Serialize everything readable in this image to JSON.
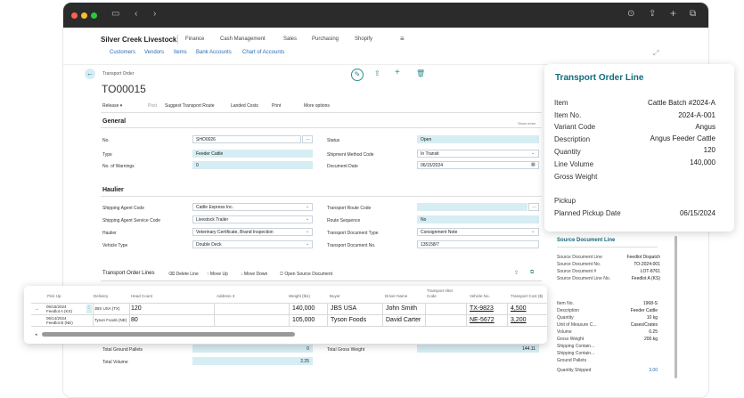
{
  "app": {
    "brand": "Silver Creek Livestock",
    "menu": [
      "Finance",
      "Cash Management",
      "Sales",
      "Purchasing",
      "Shopify"
    ],
    "subnav": [
      "Customers",
      "Vendors",
      "Items",
      "Bank Accounts",
      "Chart of Accounts"
    ]
  },
  "page": {
    "caption": "Transport Order",
    "number": "TO00015",
    "actions": [
      "Release",
      "Post",
      "Suggest Transport Route",
      "Landed Costs",
      "Print",
      "More options"
    ],
    "show_more": "Show more"
  },
  "general": {
    "title": "General",
    "fields_left": [
      {
        "label": "No.",
        "value": "SHO0026"
      },
      {
        "label": "Type",
        "value": "Feeder Cattle"
      },
      {
        "label": "No. of Warnings",
        "value": "0"
      }
    ],
    "fields_right": [
      {
        "label": "Status",
        "value": "Open"
      },
      {
        "label": "Shipment Method Code",
        "value": "In Transit"
      },
      {
        "label": "Document Date",
        "value": "06/15/2024"
      }
    ]
  },
  "haulier": {
    "title": "Haulier",
    "fields_left": [
      {
        "label": "Shipping Agent Code",
        "value": "Cattle Express Inc."
      },
      {
        "label": "Shipping Agent Service Code",
        "value": "Livestock Trailer"
      },
      {
        "label": "Haulier",
        "value": "Veterinary Certificate, Brand Inspection"
      },
      {
        "label": "Vehicle Type",
        "value": "Double Deck"
      }
    ],
    "fields_right": [
      {
        "label": "Transport Route Code",
        "value": ""
      },
      {
        "label": "Route Sequence",
        "value": "No"
      },
      {
        "label": "Transport Document Type",
        "value": "Consignment Note"
      },
      {
        "label": "Transport Document No.",
        "value": "135158/7"
      }
    ]
  },
  "lines": {
    "title": "Transport Order Lines",
    "actions": [
      "Delete Line",
      "Move Up",
      "Move Down",
      "Open Source Document"
    ],
    "headers": [
      "Pick Up",
      "Delivery",
      "Head Count",
      "Address 3",
      "Weight (lbs)",
      "Buyer",
      "Driver Name",
      "Transport Alter Code",
      "Vehicle No.",
      "Transport Cost ($)"
    ],
    "rows": [
      {
        "pickup": "06/15/2024",
        "pickup_sub": "Feedlot A (KS)",
        "delivery": "JBS USA (TX)",
        "head": "120",
        "weight": "140,000",
        "buyer": "JBS USA",
        "driver": "John Smith",
        "vehicle": "TX-9823",
        "cost": "4,500"
      },
      {
        "pickup": "06/14/2024",
        "pickup_sub": "Feedlot B (NE)",
        "delivery": "Tyson Foods (NE)",
        "head": "80",
        "weight": "105,000",
        "buyer": "Tyson Foods",
        "driver": "David Carter",
        "vehicle": "NE-5672",
        "cost": "3,200"
      }
    ]
  },
  "totals": {
    "rows": [
      {
        "label": "Total Ground Pallets",
        "value": "0"
      },
      {
        "label": "Total Volume",
        "value": "2.25"
      }
    ],
    "gross_label": "Total Gross Weight",
    "gross_value": "144.11"
  },
  "panel": {
    "title": "Transport Order Line",
    "rows": [
      {
        "label": "Item",
        "value": "Cattle Batch #2024-A"
      },
      {
        "label": "Item No.",
        "value": "2024-A-001"
      },
      {
        "label": "Variant Code",
        "value": "Angus"
      },
      {
        "label": "Description",
        "value": "Angus Feeder Cattle"
      },
      {
        "label": "Quantity",
        "value": "120"
      },
      {
        "label": "Line Volume",
        "value": "140,000"
      },
      {
        "label": "Gross Weight",
        "value": ""
      }
    ],
    "pickup_title": "Pickup",
    "pickup_date_label": "Planned Pickup Date",
    "pickup_date_value": "06/15/2024"
  },
  "source": {
    "title": "Source Document Line",
    "rows": [
      {
        "label": "Source Document Line",
        "value": "Feedlot Dispatch"
      },
      {
        "label": "Source Document No.",
        "value": "TO-2024-001"
      },
      {
        "label": "Source Document #",
        "value": "LOT-8761"
      },
      {
        "label": "Source Document Line No.",
        "value": "Feedlot A (KS)"
      }
    ],
    "rows2": [
      {
        "label": "Item No.",
        "value": "1968-S"
      },
      {
        "label": "Description",
        "value": "Feeder Cattle"
      },
      {
        "label": "Quantity",
        "value": "10 kg"
      },
      {
        "label": "Unit of Measure C...",
        "value": "Cases/Crates"
      },
      {
        "label": "Volume",
        "value": "0.25"
      },
      {
        "label": "Gross Weight",
        "value": "200.kg"
      },
      {
        "label": "Shipping Contain...",
        "value": ""
      },
      {
        "label": "Shipping Contain...",
        "value": ""
      },
      {
        "label": "Ground Pallets",
        "value": ""
      },
      {
        "label": "Quantity Shipped",
        "value": "3.00"
      }
    ]
  },
  "colors": {
    "accent": "#136b7b",
    "field_blue": "#d6edf3",
    "chrome": "#2b2b2b"
  }
}
